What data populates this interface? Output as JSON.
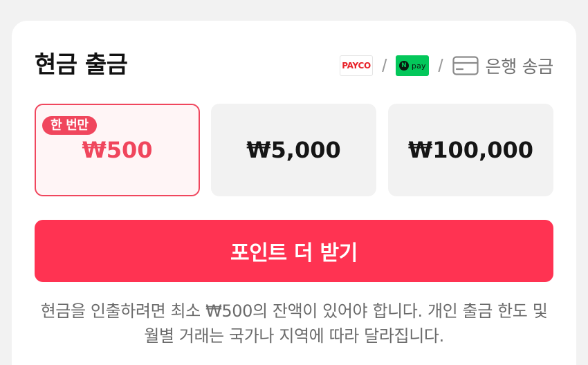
{
  "header": {
    "title": "현금 출금",
    "methods": {
      "payco_label": "PAYCO",
      "separator": "/",
      "npay_badge_letter": "N",
      "npay_label": "pay",
      "bank_label": "은행 송금"
    }
  },
  "amount_options": {
    "badge": "한 번만",
    "selected_index": 0,
    "items": [
      {
        "label": "₩500"
      },
      {
        "label": "₩5,000"
      },
      {
        "label": "₩100,000"
      }
    ]
  },
  "cta": {
    "label": "포인트 더 받기"
  },
  "notice": {
    "text": "현금을 인출하려면 최소 ₩500의 잔액이 있어야 합니다. 개인 출금 한도 및 월별 거래는 국가나 지역에 따라 달라집니다."
  },
  "colors": {
    "accent": "#ff3352",
    "selected_border": "#f0465d",
    "payco_red": "#e8232a",
    "npay_green": "#03c75a"
  },
  "icons": {
    "bank_transfer": "credit-card-icon"
  }
}
